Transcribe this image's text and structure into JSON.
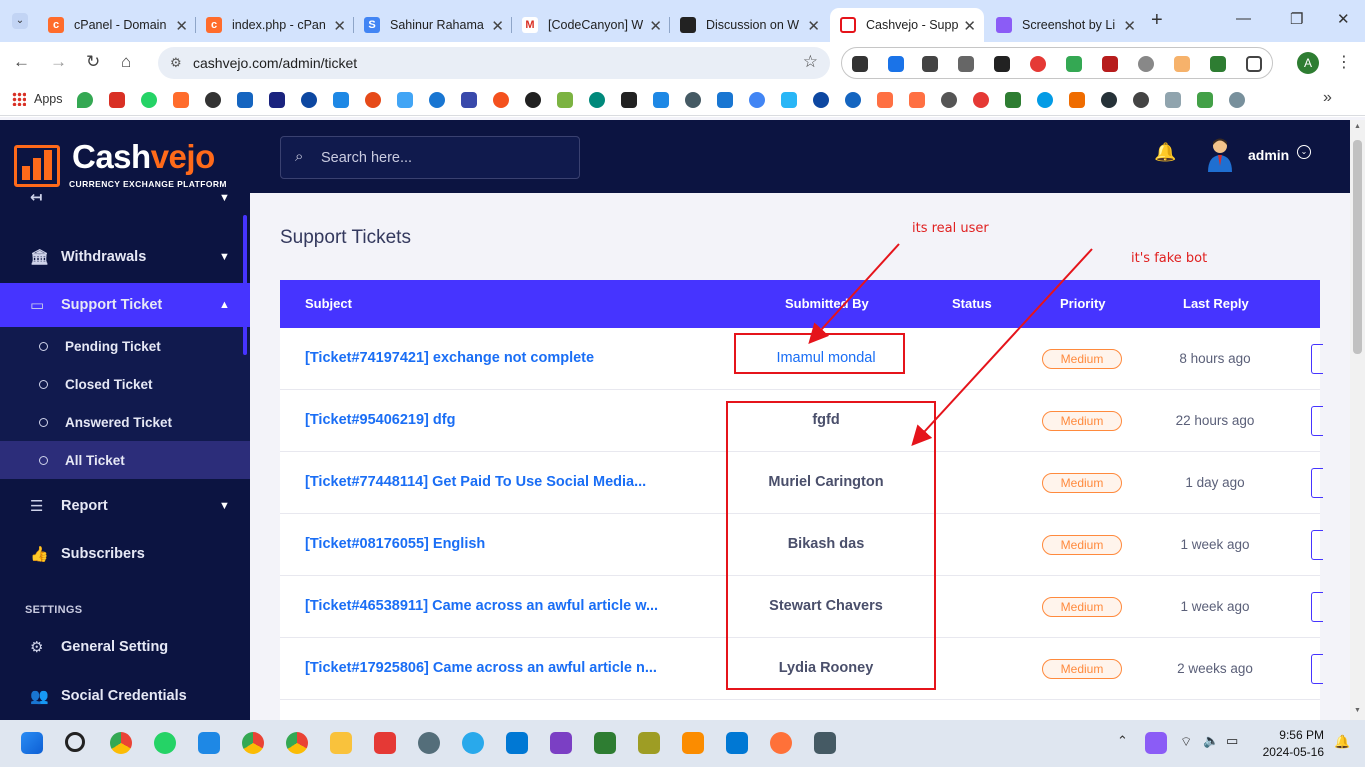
{
  "browser": {
    "tabs": [
      {
        "title": "cPanel - Domain",
        "favicon": "cpanel-icon",
        "color": "#ff6c2c"
      },
      {
        "title": "index.php - cPan",
        "favicon": "cpanel-icon",
        "color": "#ff6c2c"
      },
      {
        "title": "Sahinur Rahama",
        "favicon": "doc-icon",
        "color": "#4285f4"
      },
      {
        "title": "[CodeCanyon] W",
        "favicon": "gmail-icon",
        "color": "#d93025"
      },
      {
        "title": "Discussion on W",
        "favicon": "envato-icon",
        "color": "#222222"
      },
      {
        "title": "Cashvejo - Supp",
        "favicon": "cashvejo-icon",
        "color": "#e5141b",
        "active": true
      },
      {
        "title": "Screenshot by Li",
        "favicon": "feather-icon",
        "color": "#8b5cf6"
      }
    ],
    "url": "cashvejo.com/admin/ticket",
    "bookmarks_label": "Apps"
  },
  "brand": {
    "name_main": "Cash",
    "name_accent": "vejo",
    "tagline": "CURRENCY EXCHANGE PLATFORM",
    "accent_color": "#ff6a1a"
  },
  "sidebar": {
    "withdrawals": "Withdrawals",
    "support_ticket": "Support Ticket",
    "sub_items": [
      "Pending Ticket",
      "Closed Ticket",
      "Answered Ticket",
      "All Ticket"
    ],
    "report": "Report",
    "subscribers": "Subscribers",
    "settings_heading": "SETTINGS",
    "general_setting": "General Setting",
    "social_credentials": "Social Credentials"
  },
  "topbar": {
    "search_placeholder": "Search here...",
    "admin_name": "admin"
  },
  "main": {
    "title": "Support Tickets",
    "columns": {
      "subject": "Subject",
      "submitted_by": "Submitted By",
      "status": "Status",
      "priority": "Priority",
      "last_reply": "Last Reply"
    },
    "rows": [
      {
        "subject": "[Ticket#74197421] exchange not complete",
        "submitted_by": "Imamul mondal",
        "status": "",
        "priority": "Medium",
        "last_reply": "8 hours ago"
      },
      {
        "subject": "[Ticket#95406219] dfg",
        "submitted_by": "fgfd",
        "status": "",
        "priority": "Medium",
        "last_reply": "22 hours ago"
      },
      {
        "subject": "[Ticket#77448114] Get Paid To Use Social Media...",
        "submitted_by": "Muriel Carington",
        "status": "",
        "priority": "Medium",
        "last_reply": "1 day ago"
      },
      {
        "subject": "[Ticket#08176055] English",
        "submitted_by": "Bikash das",
        "status": "",
        "priority": "Medium",
        "last_reply": "1 week ago"
      },
      {
        "subject": "[Ticket#46538911] Came across an awful article w...",
        "submitted_by": "Stewart Chavers",
        "status": "",
        "priority": "Medium",
        "last_reply": "1 week ago"
      },
      {
        "subject": "[Ticket#17925806] Came across an awful article n...",
        "submitted_by": "Lydia Rooney",
        "status": "",
        "priority": "Medium",
        "last_reply": "2 weeks ago"
      }
    ]
  },
  "annotations": {
    "real_user": "its real user",
    "fake_bot": "it's fake bot",
    "color": "#e5141b"
  },
  "taskbar": {
    "time": "9:56 PM",
    "date": "2024-05-16"
  }
}
